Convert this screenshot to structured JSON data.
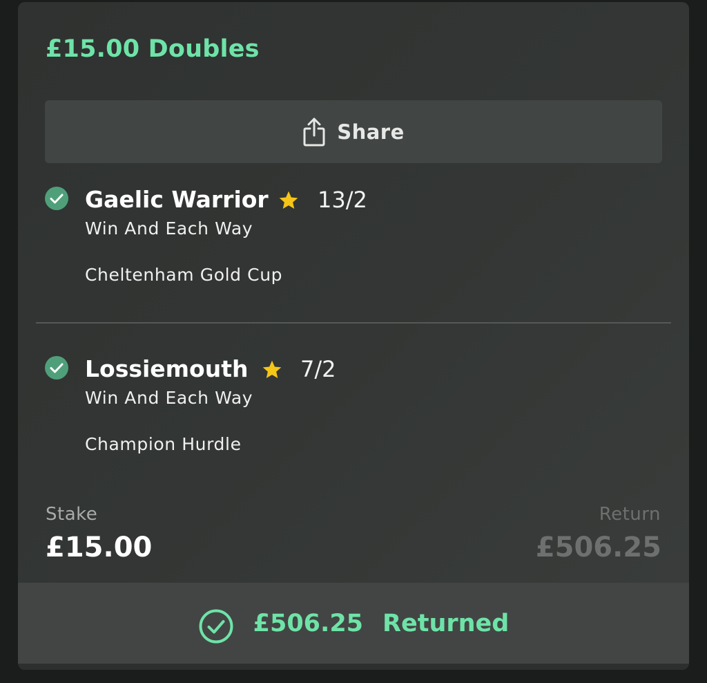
{
  "bet": {
    "title": "£15.00 Doubles"
  },
  "share": {
    "label": "Share",
    "icon": "share-icon"
  },
  "selections": [
    {
      "name": "Gaelic Warrior",
      "odds": "13/2",
      "market": "Win And Each Way",
      "event": "Cheltenham Gold Cup",
      "status_icon": "check-circle-icon",
      "star_icon": "star-icon"
    },
    {
      "name": "Lossiemouth",
      "odds": "7/2",
      "market": "Win And Each Way",
      "event": "Champion Hurdle",
      "status_icon": "check-circle-icon",
      "star_icon": "star-icon"
    }
  ],
  "summary": {
    "stake_label": "Stake",
    "stake_value": "£15.00",
    "return_label": "Return",
    "return_value": "£506.25"
  },
  "result": {
    "amount": "£506.25",
    "status": "Returned",
    "icon": "check-circle-outline-icon"
  },
  "colors": {
    "accent_green": "#6ee3a8",
    "check_green": "#4fa07a",
    "star_yellow": "#f5c518",
    "card_background": "#323533",
    "footer_background": "#434544"
  }
}
